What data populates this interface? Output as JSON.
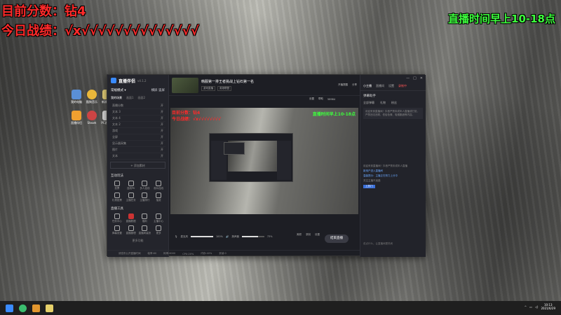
{
  "overlay": {
    "score": "目前分数：钻4",
    "record": "今日战绩：√x√√√√√√√√√√√√√√",
    "stream_time": "直播时间早上10-18点"
  },
  "desktop_icons": [
    "我的电脑",
    "酷狗音乐",
    "新建文件",
    "直播伴侣",
    "Steam",
    "PC客户端",
    "微信",
    "英雄联盟",
    "新建"
  ],
  "app": {
    "logo_text": "直播伴侣",
    "version": "v4.1.2",
    "mode_label": "常规模式 ▾",
    "mode_actions": [
      "横屏",
      "竖屏"
    ],
    "scene_tabs": [
      "我的场景",
      "画面1",
      "画面2"
    ],
    "scene_items": [
      {
        "name": "直播分数",
        "val": "开"
      },
      {
        "name": "文本 3",
        "val": "开"
      },
      {
        "name": "文本 4",
        "val": "开"
      },
      {
        "name": "文本 2",
        "val": "开"
      },
      {
        "name": "游戏",
        "val": "开"
      },
      {
        "name": "全屏",
        "val": "开"
      },
      {
        "name": "显示器采集",
        "val": "开"
      },
      {
        "name": "图片",
        "val": "开"
      },
      {
        "name": "文本",
        "val": "开"
      }
    ],
    "add_source": "+ 添加素材",
    "interactive_head": "互动玩法",
    "interactive_tools": [
      "投票",
      "连线PK",
      "多人连线",
      "观众连线",
      "礼物投票",
      "主播任务",
      "主播排行",
      "抽奖"
    ],
    "host_head": "直播工具",
    "host_tools": [
      "任务中心",
      "直播数据",
      "福利",
      "主播中心",
      "弹幕设置",
      "直播管理",
      "直播间装扮",
      "更多"
    ],
    "more_tools": "更多功能",
    "room_title": "韩服第一排王者挑战上钻石第一名",
    "room_tags": [
      "游戏直播",
      "英雄联盟"
    ],
    "room_actions": [
      "开播提醒",
      "分享",
      "设置",
      "帮助",
      "58984"
    ],
    "preview_red1": "目前分数：钻4",
    "preview_red2": "今日战绩：√x√√√√√√√√",
    "preview_green": "直播时间早上10-18点",
    "mic_label": "麦克风",
    "mic_value": "100%",
    "speaker_label": "扬声器",
    "speaker_value": "73%",
    "mic_level": 1.0,
    "speaker_level": 0.73,
    "ctrl_icons": [
      "美颜",
      "录制",
      "设置"
    ],
    "go_live": "结束直播",
    "status": [
      "请发布公开直播时间",
      "帧率:60",
      "码率:6000",
      "CPU:20%",
      "内存:40%",
      "丢帧:0"
    ],
    "right_tabs": [
      "小主播",
      "直播间",
      "设置",
      "录制中"
    ],
    "right_head": "弹幕助手",
    "right_sub": [
      "全部弹幕",
      "礼物",
      "粉丝"
    ],
    "right_box": "欢迎来到直播间！抖音严禁未成年人直播或打赏，严禁违法违规、低俗色情、吸烟酗酒等内容。",
    "right_msgs": [
      "欢迎来到直播间！抖音严禁未成年人直播",
      "新用户进入直播间",
      "温馨提示：主播正在努力上分中",
      "关注主播不迷路"
    ],
    "right_tag": "上热门",
    "right_input": "说点什么，让直播间更热闹"
  },
  "taskbar": {
    "time": "10:13",
    "date": "2021/6/29"
  }
}
